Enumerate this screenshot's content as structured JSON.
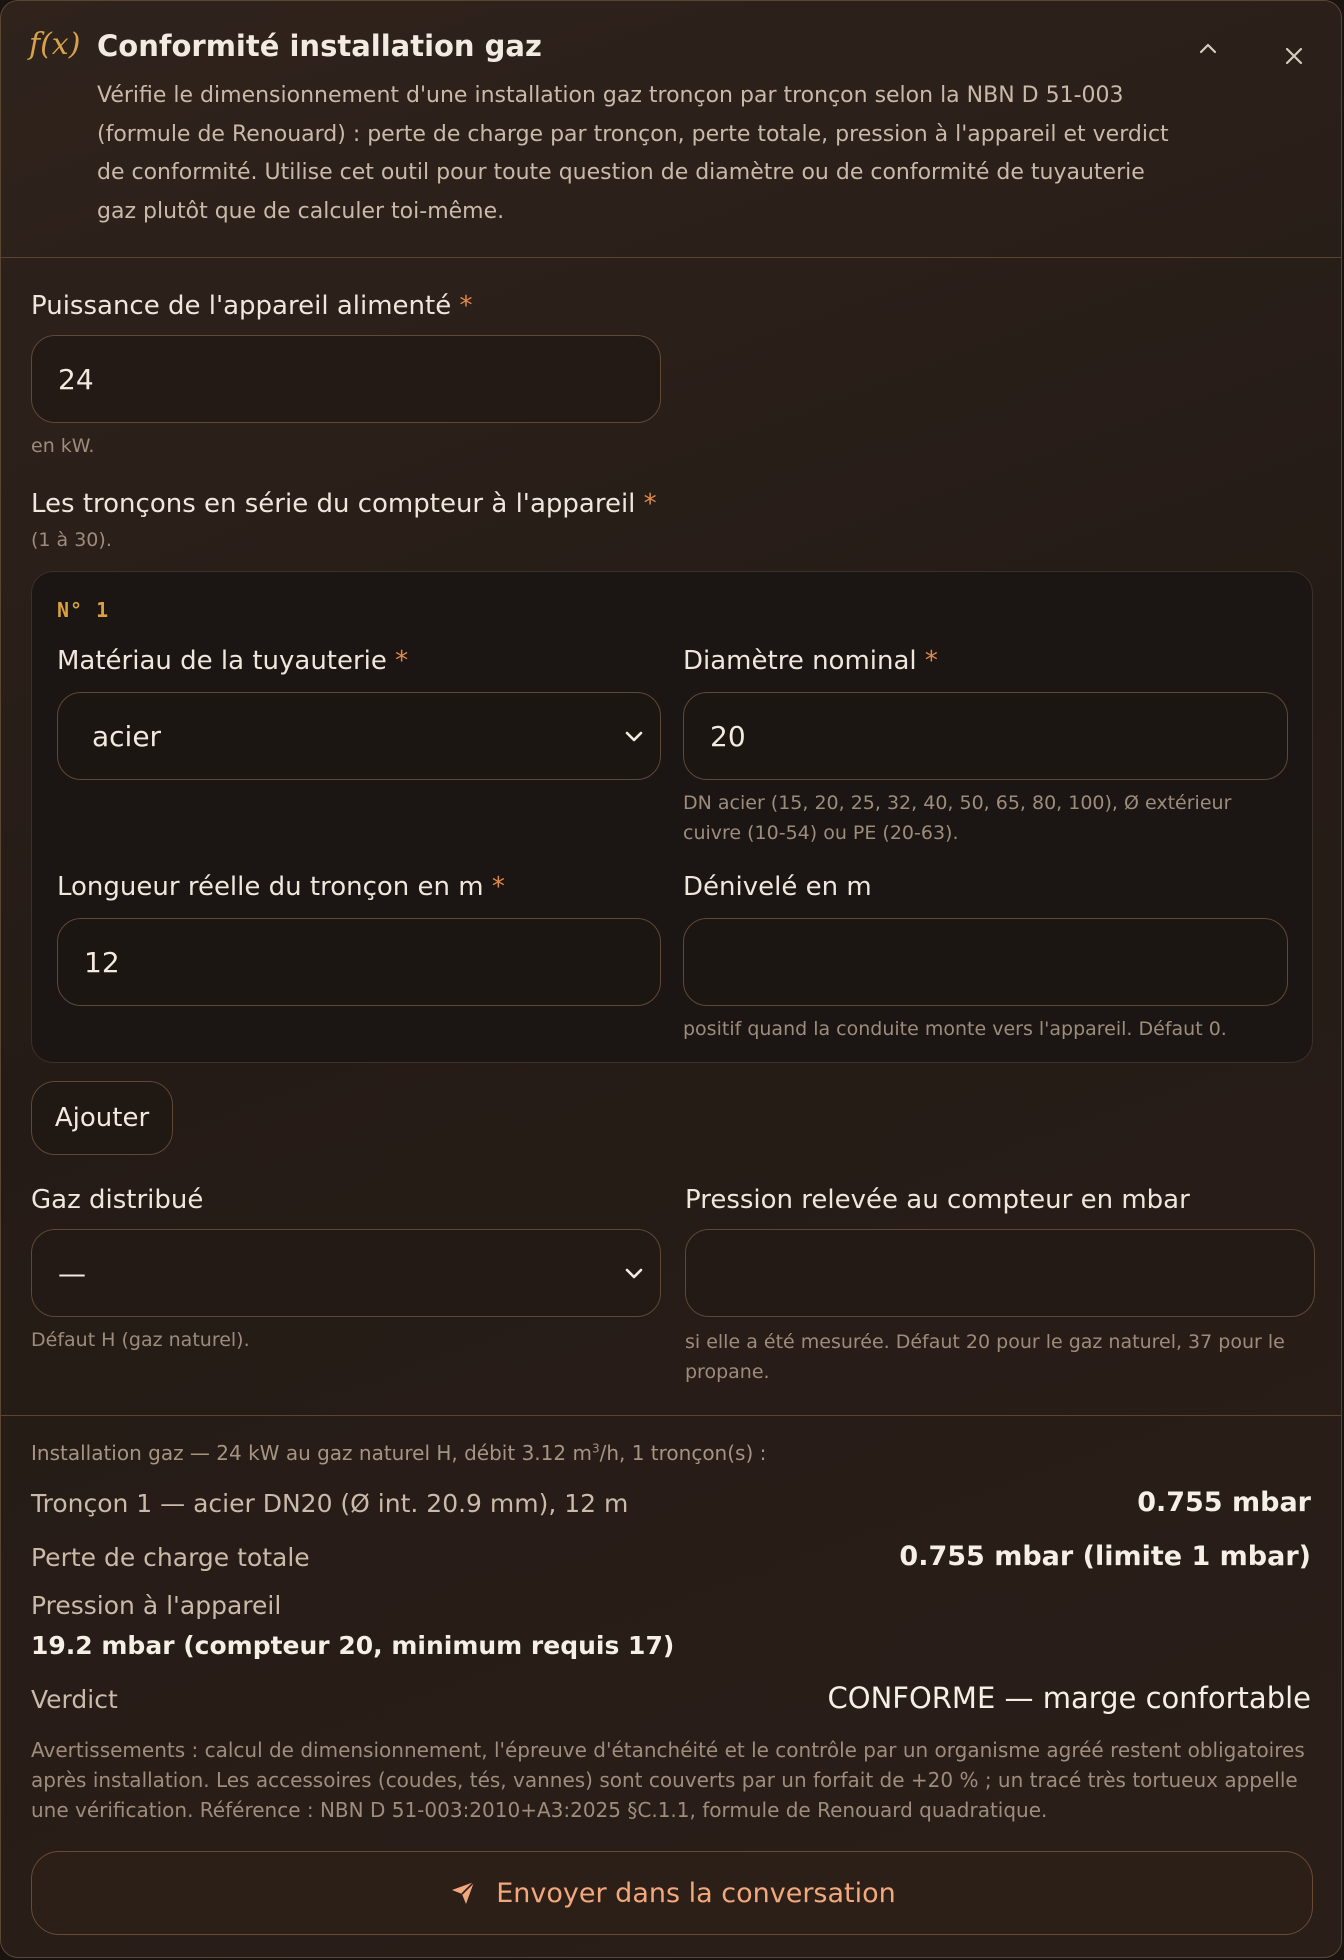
{
  "header": {
    "fx": "f(x)",
    "title": "Conformité installation gaz",
    "description": "Vérifie le dimensionnement d'une installation gaz tronçon par tronçon selon la NBN D 51-003 (formule de Renouard) : perte de charge par tronçon, perte totale, pression à l'appareil et verdict de conformité. Utilise cet outil pour toute question de diamètre ou de conformité de tuyauterie gaz plutôt que de calculer toi-même."
  },
  "power": {
    "label": "Puissance de l'appareil alimenté",
    "required": "*",
    "value": "24",
    "hint": "en kW."
  },
  "segments": {
    "label": "Les tronçons en série du compteur à l'appareil",
    "required": "*",
    "hint": "(1 à 30).",
    "items": [
      {
        "index": "N° 1",
        "material_label": "Matériau de la tuyauterie",
        "material_value": "acier",
        "diameter_label": "Diamètre nominal",
        "diameter_value": "20",
        "diameter_hint": "DN acier (15, 20, 25, 32, 40, 50, 65, 80, 100), Ø extérieur cuivre (10-54) ou PE (20-63).",
        "length_label": "Longueur réelle du tronçon en m",
        "length_value": "12",
        "elevation_label": "Dénivelé en m",
        "elevation_value": "",
        "elevation_hint": "positif quand la conduite monte vers l'appareil. Défaut 0."
      }
    ],
    "add_label": "Ajouter"
  },
  "gas": {
    "label": "Gaz distribué",
    "value": "—",
    "hint": "Défaut H (gaz naturel)."
  },
  "pressure": {
    "label": "Pression relevée au compteur en mbar",
    "value": "",
    "hint": "si elle a été mesurée. Défaut 20 pour le gaz naturel, 37 pour le propane."
  },
  "result": {
    "summary_pre": "Installation gaz — 24 kW au gaz naturel H, débit 3.12 m",
    "summary_sup": "3",
    "summary_post": "/h, 1 tronçon(s) :",
    "segment_label": "Tronçon 1 — acier DN20 (Ø int. 20.9 mm), 12 m",
    "segment_value": "0.755 mbar",
    "total_label": "Perte de charge totale",
    "total_value": "0.755 mbar (limite 1 mbar)",
    "appliance_label": "Pression à l'appareil",
    "appliance_value": "19.2 mbar (compteur 20, minimum requis 17)",
    "verdict_label": "Verdict",
    "verdict_value": "CONFORME — marge confortable",
    "warnings": "Avertissements : calcul de dimensionnement, l'épreuve d'étanchéité et le contrôle par un organisme agréé restent obligatoires après installation. Les accessoires (coudes, tés, vannes) sont couverts par un forfait de +20 % ; un tracé très tortueux appelle une vérification. Référence : NBN D 51-003:2010+A3:2025 §C.1.1, formule de Renouard quadratique."
  },
  "send": {
    "label": "Envoyer dans la conversation",
    "icon": "send-icon"
  },
  "colors": {
    "accent": "#d9a03f",
    "send_text": "#f3a77d",
    "required": "#e1894c"
  }
}
